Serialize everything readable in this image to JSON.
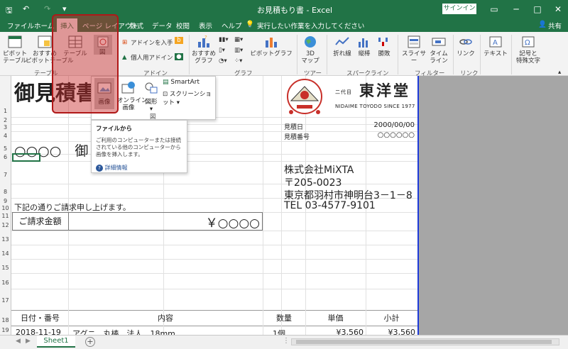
{
  "titlebar": {
    "title": "お見積もり書 - Excel",
    "signin": "サインイン",
    "buttons": [
      "─",
      "□",
      "✕"
    ],
    "ribbon_toggle": "▭"
  },
  "tabs": [
    "ファイル",
    "ホーム",
    "挿入",
    "ページ レイアウト",
    "数式",
    "データ",
    "校閲",
    "表示",
    "ヘルプ"
  ],
  "active_tab": "挿入",
  "tell_me": "実行したい作業を入力してください",
  "share": "共有",
  "ribbon": {
    "tables": {
      "pivot": "ピボット\nテーブル",
      "recommended_pivot": "おすすめ\nピボットテーブル",
      "table": "テーブル",
      "group": "テーブル"
    },
    "illustrations": {
      "zu": "図"
    },
    "addins": {
      "get": "アドインを入手",
      "personal": "個人用アドイン",
      "group": "アドイン"
    },
    "charts": {
      "recommended": "おすすめ\nグラフ",
      "pivot_chart": "ピボットグラフ",
      "group": "グラフ"
    },
    "tours": {
      "map3d": "3D\nマップ",
      "group": "ツアー"
    },
    "sparklines": {
      "line": "折れ線",
      "column": "縦棒",
      "winloss": "勝敗",
      "group": "スパークライン"
    },
    "filters": {
      "slicer": "スライサー",
      "timeline": "タイム\nライン",
      "group": "フィルター"
    },
    "links": {
      "link": "リンク",
      "group": "リンク"
    },
    "text": {
      "text": "テキスト"
    },
    "symbols": {
      "symbols": "記号と\n特殊文字"
    }
  },
  "dropdown": {
    "image": "画像",
    "online_image": "オンライン\n画像",
    "shapes": "図形",
    "smartart": "SmartArt",
    "screenshot": "スクリーンショット",
    "group": "図"
  },
  "tooltip": {
    "title": "ファイルから",
    "body": "ご利用のコンピューターまたは接続されている他のコンピューターから画像を挿入します。",
    "more": "詳細情報"
  },
  "rows": [
    "1",
    "2",
    "3",
    "4",
    "5",
    "6",
    "7",
    "8",
    "9",
    "10",
    "11",
    "12",
    "13",
    "14",
    "15",
    "16",
    "17",
    "18",
    "19"
  ],
  "sheet": {
    "doc_title": "御見積書",
    "client": "○○○○　御",
    "company_mark": "東洋堂",
    "company_prefix": "二代目",
    "company_sub": "NIDAIME TOYODO SINCE 1977",
    "date_label": "見積日",
    "date_value": "2000/00/00",
    "num_label": "見積番号",
    "num_value": "○○○○○○",
    "company": "株式会社MiXTA",
    "postal": "〒205-0023",
    "address": "東京都羽村市神明台3－1－8",
    "tel": "TEL 03-4577-9101",
    "intro": "下記の通りご請求申し上げます。",
    "amount_label": "ご請求金額",
    "amount_value": "￥○○○○",
    "table_headers": [
      "日付・番号",
      "内容",
      "数量",
      "単価",
      "小計"
    ],
    "first_row": [
      "2018-11-19",
      "アグニ　丸棒　法人　18mm",
      "1個",
      "¥3,560",
      "¥3,560"
    ]
  },
  "sheet_tab": "Sheet1",
  "add_sheet": "+"
}
